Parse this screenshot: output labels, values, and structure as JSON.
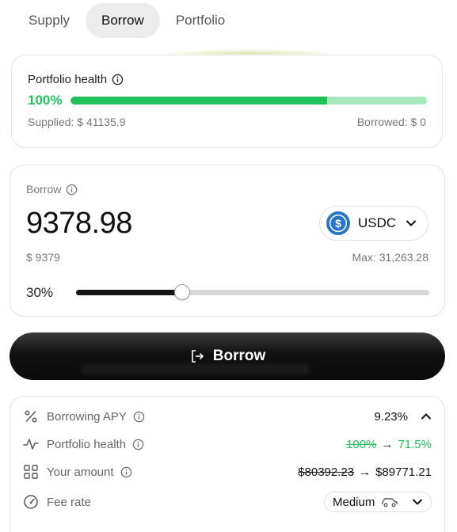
{
  "tabs": [
    {
      "label": "Supply",
      "active": false
    },
    {
      "label": "Borrow",
      "active": true
    },
    {
      "label": "Portfolio",
      "active": false
    }
  ],
  "health": {
    "title": "Portfolio health",
    "percent": "100%",
    "bar_fill_fraction": 0.72,
    "supplied": "Supplied: $ 41135.9",
    "borrowed": "Borrowed: $ 0"
  },
  "borrow": {
    "title": "Borrow",
    "amount": "9378.98",
    "token": "USDC",
    "usd_value": "$ 9379",
    "max": "Max: 31,263.28",
    "slider_percent_label": "30%",
    "slider_fraction": 0.3
  },
  "action": {
    "label": "Borrow"
  },
  "details": {
    "borrowing_apy_label": "Borrowing APY",
    "borrowing_apy_value": "9.23%",
    "portfolio_health_label": "Portfolio health",
    "portfolio_health_old": "100%",
    "portfolio_health_arrow": "→",
    "portfolio_health_new": "71.5%",
    "your_amount_label": "Your amount",
    "your_amount_old": "$80392.23",
    "your_amount_arrow": "→",
    "your_amount_new": "$89771.21",
    "fee_rate_label": "Fee rate",
    "fee_rate_value": "Medium"
  },
  "colors": {
    "accent_green": "#22c25a",
    "bar_light_green": "#a7e8bf",
    "button_dark": "#111111",
    "usdc_blue": "#2775ca"
  },
  "icons": {
    "info": "info-circle-icon",
    "token": "usdc-icon",
    "dropdown": "chevron-down-icon",
    "action": "exit-arrow-icon",
    "apy": "percent-icon",
    "health": "pulse-icon",
    "amount": "grid-icon",
    "fee": "gauge-icon",
    "collapse": "chevron-up-icon",
    "speed": "car-icon"
  }
}
